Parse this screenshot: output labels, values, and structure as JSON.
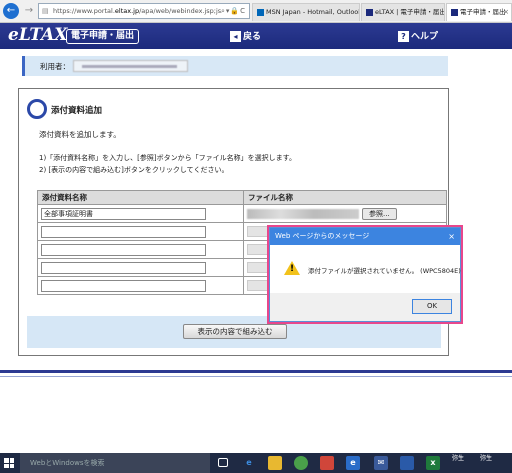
{
  "browser": {
    "url_prefix": "https://www.portal.",
    "url_domain": "eltax.jp",
    "url_rest": "/apa/web/webindex.jsp;jsessio",
    "tabs": [
      {
        "label": "MSN Japan - Hotmail, Outlook...",
        "active": false
      },
      {
        "label": "eLTAX | 電子申請・届出",
        "active": false
      },
      {
        "label": "電子申請・届出",
        "active": true
      }
    ]
  },
  "header": {
    "logo": "eLTAX",
    "tag": "電子申請・届出",
    "back_label": "戻る",
    "help_label": "ヘルプ"
  },
  "userbar": {
    "label": "利用者："
  },
  "panel": {
    "title": "添付資料追加",
    "description": "添付資料を追加します。",
    "instruction_1": "1)「添付資料名称」を入力し、[参照]ボタンから「ファイル名称」を選択します。",
    "instruction_2": "2) [表示の内容で組み込む]ボタンをクリックしてください。",
    "columns": [
      "添付資料名称",
      "ファイル名称"
    ],
    "first_row_name": "全部事項証明書",
    "browse_label": "参照...",
    "submit_label": "表示の内容で組み込む"
  },
  "dialog": {
    "title": "Web ページからのメッセージ",
    "close": "×",
    "message": "添付ファイルが選択されていません。 (WPC5804E)",
    "ok_label": "OK"
  },
  "taskbar": {
    "search_placeholder": "WebとWindowsを検索",
    "tray_1": "弥生",
    "tray_2": "弥生"
  },
  "colors": {
    "header_bg": "#1c2a7c",
    "dialog_title": "#3c84e0",
    "highlight": "#e8478c",
    "userbar_bg": "#d8e8f6"
  }
}
